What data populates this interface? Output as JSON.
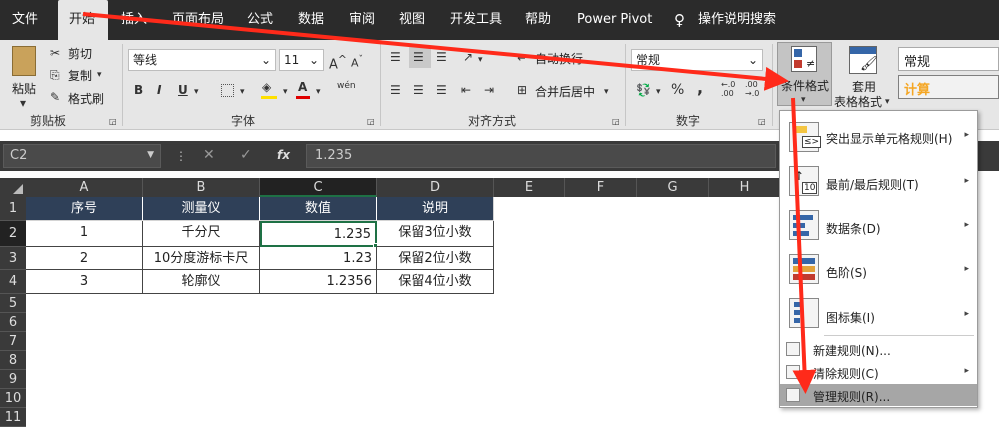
{
  "menu": {
    "tabs": [
      "文件",
      "开始",
      "插入",
      "页面布局",
      "公式",
      "数据",
      "审阅",
      "视图",
      "开发工具",
      "帮助",
      "Power Pivot"
    ],
    "active": "开始",
    "search": "操作说明搜索"
  },
  "ribbon": {
    "clipboard": {
      "paste": "粘贴",
      "cut": "剪切",
      "copy": "复制",
      "format_painter": "格式刷",
      "group": "剪贴板"
    },
    "font": {
      "name": "等线",
      "size": "11",
      "bold": "B",
      "italic": "I",
      "underline": "U",
      "phonetic": "wén",
      "group": "字体"
    },
    "alignment": {
      "wrap": "自动换行",
      "merge": "合并后居中",
      "group": "对齐方式"
    },
    "number": {
      "format": "常规",
      "percent": "%",
      "comma": ",",
      "group": "数字"
    },
    "styles": {
      "conditional": "条件格式",
      "table_format_1": "套用",
      "table_format_2": "表格格式",
      "style_normal": "常规",
      "style_calc": "计算"
    }
  },
  "formula_bar": {
    "name_box": "C2",
    "fx": "fx",
    "value": "1.235"
  },
  "columns": [
    "A",
    "B",
    "C",
    "D",
    "E",
    "F",
    "G",
    "H"
  ],
  "rows": [
    "1",
    "2",
    "3",
    "4",
    "5",
    "6",
    "7",
    "8",
    "9",
    "10",
    "11"
  ],
  "table": {
    "headers": [
      "序号",
      "测量仪",
      "数值",
      "说明"
    ],
    "rows": [
      [
        "1",
        "千分尺",
        "1.235",
        "保留3位小数"
      ],
      [
        "2",
        "10分度游标卡尺",
        "1.23",
        "保留2位小数"
      ],
      [
        "3",
        "轮廓仪",
        "1.2356",
        "保留4位小数"
      ]
    ]
  },
  "dropdown": {
    "items": [
      {
        "label": "突出显示单元格规则(H)",
        "icon": "highlight-rules-icon"
      },
      {
        "label": "最前/最后规则(T)",
        "icon": "top-bottom-rules-icon"
      },
      {
        "label": "数据条(D)",
        "icon": "data-bars-icon"
      },
      {
        "label": "色阶(S)",
        "icon": "color-scales-icon"
      },
      {
        "label": "图标集(I)",
        "icon": "icon-sets-icon"
      }
    ],
    "small_items": [
      {
        "label": "新建规则(N)..."
      },
      {
        "label": "清除规则(C)"
      },
      {
        "label": "管理规则(R)..."
      }
    ]
  },
  "colors": {
    "header_fill": "#2f4058",
    "arrow": "#ff2a1a",
    "menubar": "#2b2b2b",
    "highlight": "#a6a6a6",
    "calc_text": "#f5a623"
  }
}
